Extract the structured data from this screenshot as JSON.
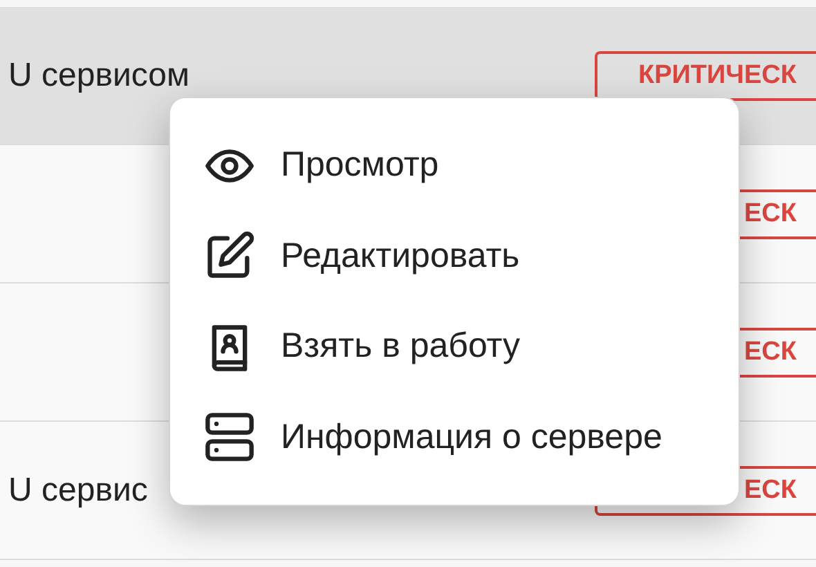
{
  "table": {
    "rows": [
      {
        "text": "U сервисом",
        "selected": true,
        "badge": "КРИТИЧЕСК"
      },
      {
        "text": "",
        "selected": false,
        "badge": "ЕСК"
      },
      {
        "text": "",
        "selected": false,
        "badge": "ЕСК"
      },
      {
        "text": "U сервис",
        "selected": false,
        "badge": "ЕСК"
      }
    ]
  },
  "context_menu": {
    "items": [
      {
        "kind": "view",
        "label": "Просмотр"
      },
      {
        "kind": "edit",
        "label": "Редактировать"
      },
      {
        "kind": "take",
        "label": "Взять в работу"
      },
      {
        "kind": "server",
        "label": "Информация о сервере"
      }
    ]
  }
}
